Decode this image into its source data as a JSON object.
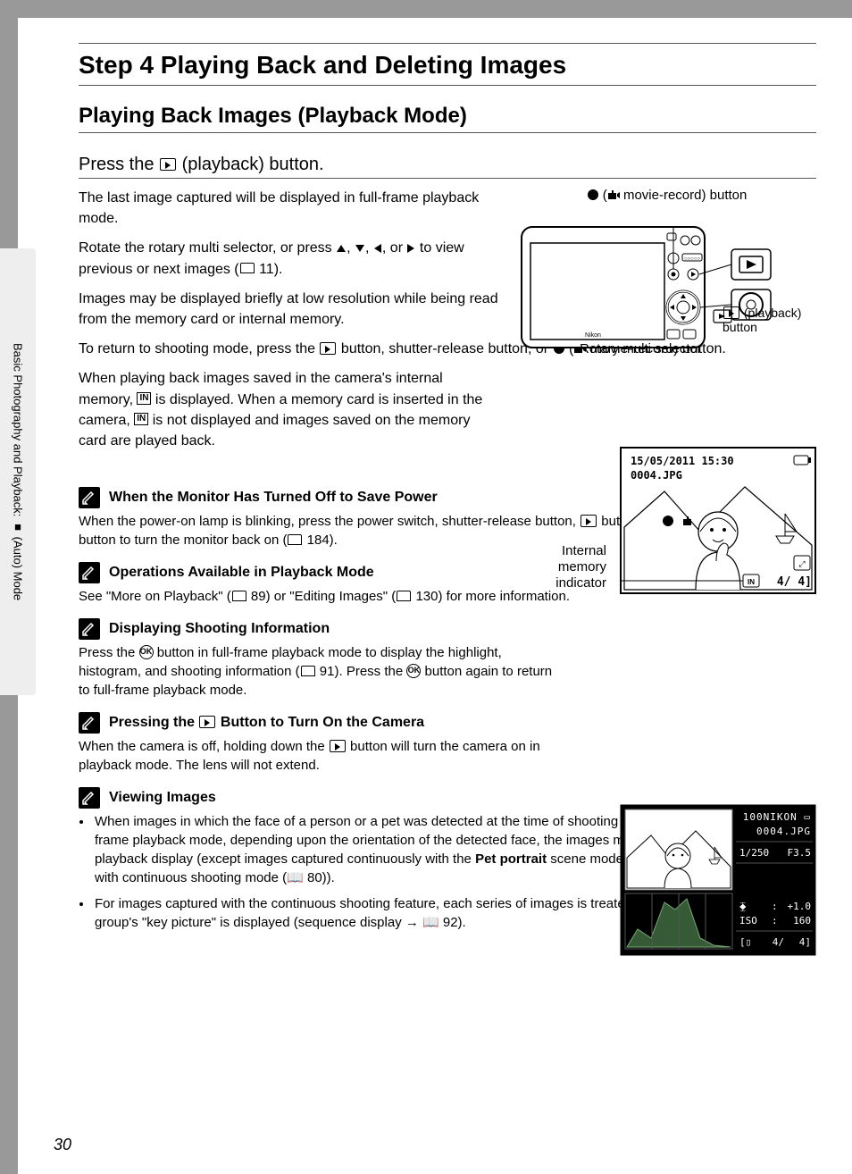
{
  "page_number": "30",
  "sidebar_text": "Basic Photography and Playback: 📷 (Auto) Mode",
  "step_title": "Step 4 Playing Back and Deleting Images",
  "section_title": "Playing Back Images (Playback Mode)",
  "subhead": "Press the ▶ (playback) button.",
  "p1": "The last image captured will be displayed in full-frame playback mode.",
  "p2": "Rotate the rotary multi selector, or press ▲, ▼, ◀, or ▶ to view previous or next images (📖 11).",
  "p3": "Images may be displayed briefly at low resolution while being read from the memory card or internal memory.",
  "p4": "To return to shooting mode, press the ▶ button, shutter-release button, or ● (🎥 movie-record) button.",
  "p5": "When playing back images saved in the camera's internal memory, 🅸 is displayed. When a memory card is inserted in the camera, 🅸 is not displayed and images saved on the memory card are played back.",
  "camera_labels": {
    "movie_record": "● (🎥 movie-record) button",
    "playback": "▶ (playback) button",
    "rotary": "Rotary multi selector"
  },
  "preview1": {
    "date": "15/05/2011 15:30",
    "filename": "0004.JPG",
    "count": "4/   4",
    "label": "Internal memory indicator"
  },
  "preview2": {
    "folder": "100NIKON",
    "filename": "0004.JPG",
    "shutter": "1/250",
    "aperture": "F3.5",
    "ev": "+1.0",
    "iso": "160",
    "count_a": "4/",
    "count_b": "4]",
    "iso_label": "ISO"
  },
  "note1_title": "When the Monitor Has Turned Off to Save Power",
  "note1_body": "When the power-on lamp is blinking, press the power switch, shutter-release button, ▶ button, or ● (🎥 movie-record) button to turn the monitor back on (📖 184).",
  "note2_title": "Operations Available in Playback Mode",
  "note2_body": "See \"More on Playback\" (📖 89) or \"Editing Images\" (📖 130) for more information.",
  "note3_title": "Displaying Shooting Information",
  "note3_body": "Press the ⊛ button in full-frame playback mode to display the highlight, histogram, and shooting information (📖 91). Press the ⊛ button again to return to full-frame playback mode.",
  "note4_title": "Pressing the ▶ Button to Turn On the Camera",
  "note4_body": "When the camera is off, holding down the ▶ button will turn the camera on in playback mode. The lens will not extend.",
  "note5_title": "Viewing Images",
  "note5_bullet1_a": "When images in which the face of a person or a pet was detected at the time of shooting (📖 56, 74) are displayed in full-frame playback mode, depending upon the orientation of the detected face, the images may be automatically rotated for playback display (except images captured continuously with the ",
  "note5_bullet1_bold": "Pet portrait",
  "note5_bullet1_b": " scene mode (📖 74) or images captured with continuous shooting mode (📖 80)).",
  "note5_bullet2": "For images captured with the continuous shooting feature, each series of images is treated as a group, and only the group's \"key picture\" is displayed (sequence display → 📖 92)."
}
